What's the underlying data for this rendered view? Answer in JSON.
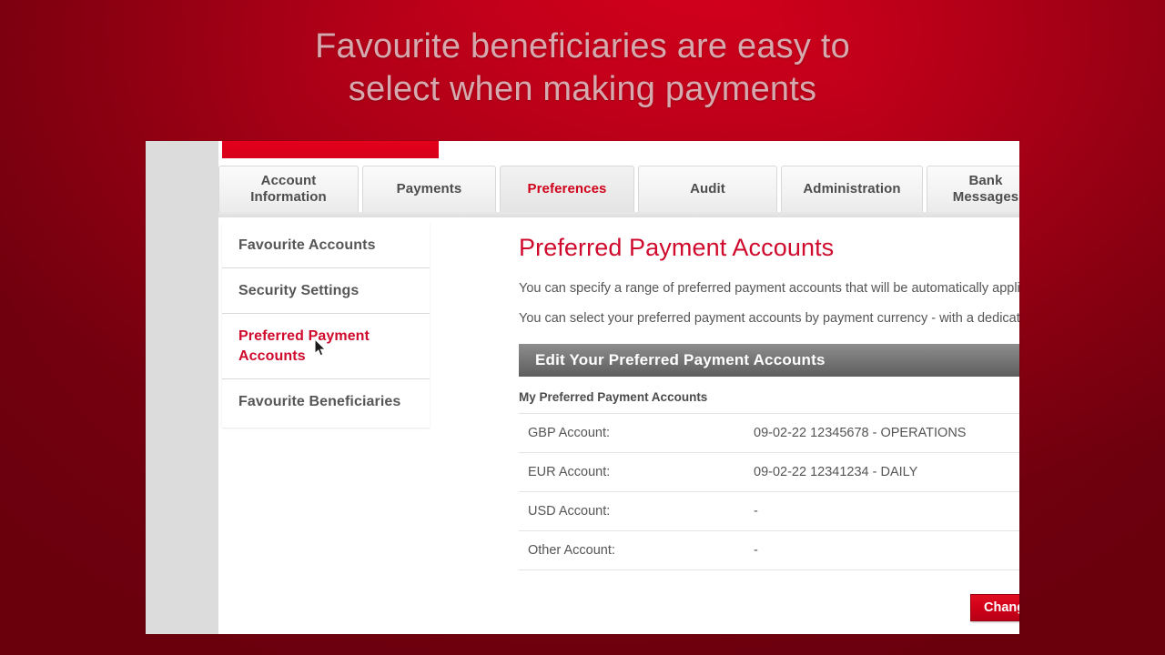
{
  "caption": {
    "line1": "Favourite beneficiaries are easy to",
    "line2": "select when making payments"
  },
  "colors": {
    "brand_red": "#cf0a2c",
    "banner_red": "#d7001a",
    "backdrop_red": "#ad0017",
    "section_bar_gray": "#7a7a7a",
    "caption_text": "#d6a9ae"
  },
  "tabs": [
    {
      "label": "Account\nInformation",
      "active": false
    },
    {
      "label": "Payments",
      "active": false
    },
    {
      "label": "Preferences",
      "active": true
    },
    {
      "label": "Audit",
      "active": false
    },
    {
      "label": "Administration",
      "active": false
    },
    {
      "label": "Bank\nMessages",
      "active": false
    }
  ],
  "sidebar": {
    "items": [
      {
        "label": "Favourite Accounts",
        "active": false
      },
      {
        "label": "Security Settings",
        "active": false
      },
      {
        "label": "Preferred Payment Accounts",
        "active": true
      },
      {
        "label": "Favourite Beneficiaries",
        "active": false
      }
    ]
  },
  "main": {
    "title": "Preferred Payment Accounts",
    "intro1": "You can specify a range of preferred payment accounts that will be automatically applied wh",
    "intro2": "You can select your preferred payment accounts by payment currency - with a dedicated acc",
    "section_bar": "Edit Your Preferred Payment Accounts",
    "subhead": "My Preferred Payment Accounts",
    "accounts": [
      {
        "label": "GBP Account:",
        "value": "09-02-22 12345678   -   OPERATIONS"
      },
      {
        "label": "EUR Account:",
        "value": "09-02-22 12341234   -   DAILY"
      },
      {
        "label": "USD Account:",
        "value": "-"
      },
      {
        "label": "Other Account:",
        "value": "-"
      }
    ],
    "change_button": "Change Preferred Payment Accounts"
  }
}
